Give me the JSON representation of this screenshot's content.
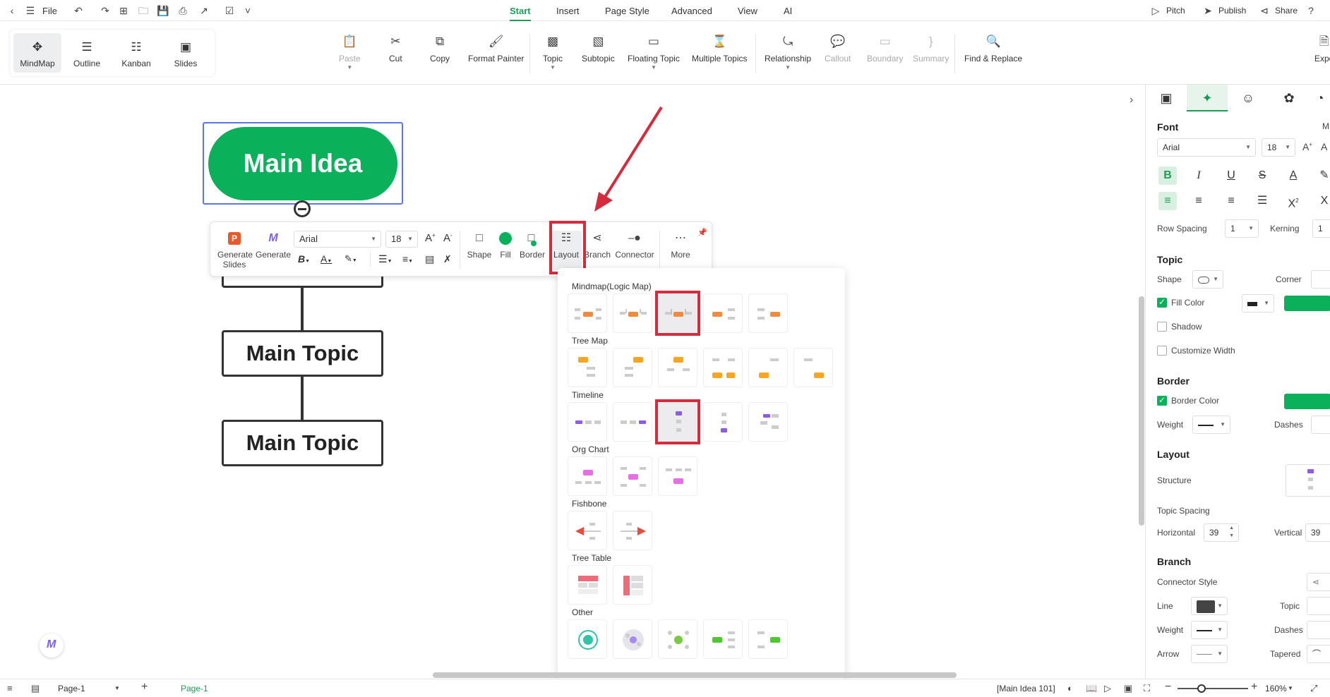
{
  "menubar": {
    "file": "File",
    "tabs": [
      "Start",
      "Insert",
      "Page Style",
      "Advanced",
      "View",
      "AI"
    ],
    "active_tab": "Start",
    "pitch": "Pitch",
    "publish": "Publish",
    "share": "Share"
  },
  "views": [
    "MindMap",
    "Outline",
    "Kanban",
    "Slides"
  ],
  "ribbon": {
    "paste": "Paste",
    "cut": "Cut",
    "copy": "Copy",
    "format_painter": "Format Painter",
    "topic": "Topic",
    "subtopic": "Subtopic",
    "floating_topic": "Floating Topic",
    "multiple_topics": "Multiple Topics",
    "relationship": "Relationship",
    "callout": "Callout",
    "boundary": "Boundary",
    "summary": "Summary",
    "find_replace": "Find & Replace",
    "export": "Expo"
  },
  "canvas": {
    "main_idea": "Main Idea",
    "topic1": "Main Topic",
    "topic2": "Main Topic"
  },
  "float_toolbar": {
    "generate_slides_1": "Generate",
    "generate_slides_2": "Slides",
    "generate": "Generate",
    "font": "Arial",
    "size": "18",
    "shape": "Shape",
    "fill": "Fill",
    "border": "Border",
    "layout": "Layout",
    "branch": "Branch",
    "connector": "Connector",
    "more": "More"
  },
  "layout_panel": {
    "categories": [
      "Mindmap(Logic Map)",
      "Tree Map",
      "Timeline",
      "Org Chart",
      "Fishbone",
      "Tree Table",
      "Other"
    ]
  },
  "sidebar": {
    "font_h": "Font",
    "font_name": "Arial",
    "font_size": "18",
    "m_cut": "M",
    "row_spacing": "Row Spacing",
    "row_spacing_val": "1",
    "kerning": "Kerning",
    "kerning_val": "1",
    "topic_h": "Topic",
    "shape": "Shape",
    "corner": "Corner",
    "fill_color": "Fill Color",
    "shadow": "Shadow",
    "customize_width": "Customize Width",
    "border_h": "Border",
    "border_color": "Border Color",
    "weight": "Weight",
    "dashes": "Dashes",
    "layout_h": "Layout",
    "structure": "Structure",
    "topic_spacing": "Topic Spacing",
    "horizontal": "Horizontal",
    "horizontal_val": "39",
    "vertical": "Vertical",
    "vertical_val": "39",
    "branch_h": "Branch",
    "connector_style": "Connector Style",
    "line": "Line",
    "topic": "Topic",
    "weight2": "Weight",
    "dashes2": "Dashes",
    "arrow": "Arrow",
    "tapered": "Tapered"
  },
  "status": {
    "page_select": "Page-1",
    "page_tab": "Page-1",
    "selection": "[Main Idea 101]",
    "zoom": "160%"
  },
  "colors": {
    "accent": "#1a9e55",
    "main_idea": "#0bb05a",
    "highlight": "#d62b3a",
    "selection": "#5b77f0"
  }
}
